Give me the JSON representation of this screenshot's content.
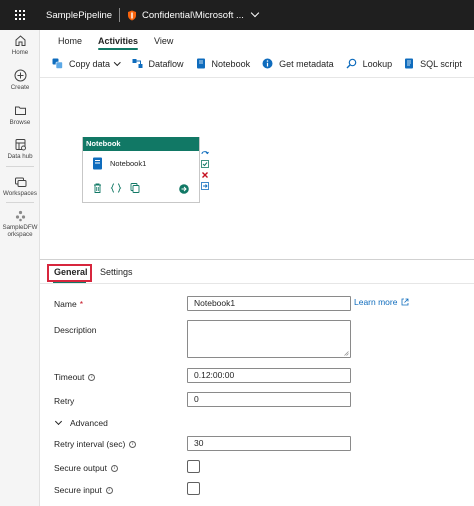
{
  "titlebar": {
    "app_title": "SamplePipeline",
    "sensitivity_label": "Confidential\\Microsoft ..."
  },
  "rail": {
    "items": [
      {
        "label": "Home",
        "icon": "home-icon"
      },
      {
        "label": "Create",
        "icon": "plus-circle-icon"
      },
      {
        "label": "Browse",
        "icon": "folder-icon"
      },
      {
        "label": "Data hub",
        "icon": "data-hub-icon"
      },
      {
        "label": "Workspaces",
        "icon": "workspaces-icon"
      },
      {
        "label_line1": "SampleDFW",
        "label_line2": "orkspace",
        "icon": "workspace-icon"
      }
    ]
  },
  "menu": {
    "tabs": [
      "Home",
      "Activities",
      "View"
    ],
    "active": "Activities"
  },
  "toolbar": {
    "copy_data": "Copy data",
    "dataflow": "Dataflow",
    "notebook": "Notebook",
    "get_metadata": "Get metadata",
    "lookup": "Lookup",
    "sql_script": "SQL script"
  },
  "activity": {
    "type": "Notebook",
    "name": "Notebook1",
    "header_color": "#117865"
  },
  "properties": {
    "tabs": [
      "General",
      "Settings"
    ],
    "active": "General",
    "name_label": "Name",
    "required_mark": "*",
    "name_value": "Notebook1",
    "learn_more": "Learn more",
    "description_label": "Description",
    "description_value": "",
    "timeout_label": "Timeout",
    "timeout_value": "0.12:00:00",
    "retry_label": "Retry",
    "retry_value": "0",
    "advanced_label": "Advanced",
    "retry_interval_label": "Retry interval (sec)",
    "retry_interval_value": "30",
    "secure_output_label": "Secure output",
    "secure_output_checked": false,
    "secure_input_label": "Secure input",
    "secure_input_checked": false
  },
  "colors": {
    "accent": "#117865",
    "link": "#0f6cbd",
    "highlight": "#d7263d",
    "topbar": "#1f1f1f"
  }
}
